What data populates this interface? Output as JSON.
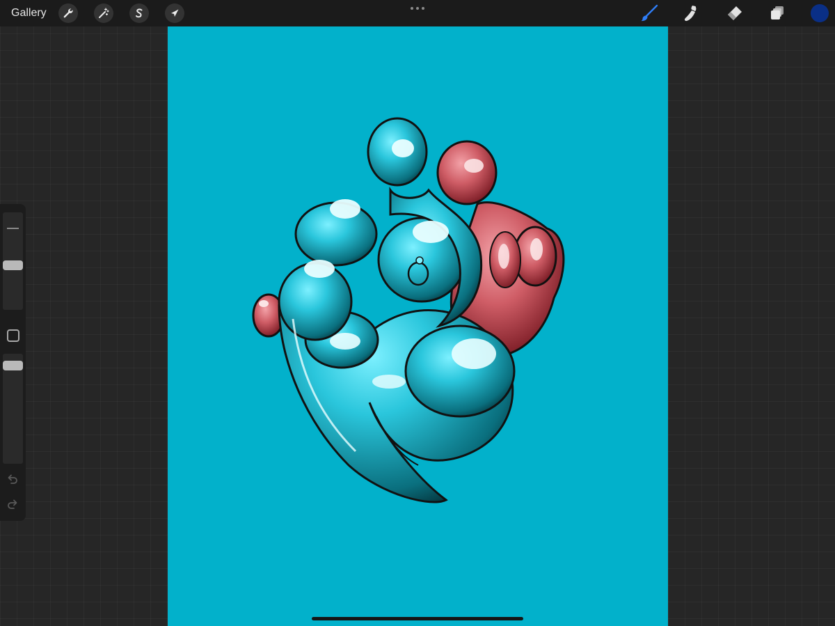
{
  "topbar": {
    "gallery_label": "Gallery",
    "left_tools": [
      "wrench-icon",
      "magic-wand-icon",
      "selection-icon",
      "transform-arrow-icon"
    ],
    "right_tools": [
      "brush-icon",
      "smudge-icon",
      "eraser-icon",
      "layers-icon"
    ],
    "active_tool": "brush-icon",
    "active_color": "#0a2f86",
    "accent_color": "#2f7df6"
  },
  "sidebar": {
    "brush_size_level": 0.1,
    "opacity_level": 0.05,
    "icons": [
      "undo-icon",
      "redo-icon"
    ]
  },
  "canvas": {
    "background_color": "#02b1cb",
    "artwork": "abstract-figure-illustration"
  }
}
